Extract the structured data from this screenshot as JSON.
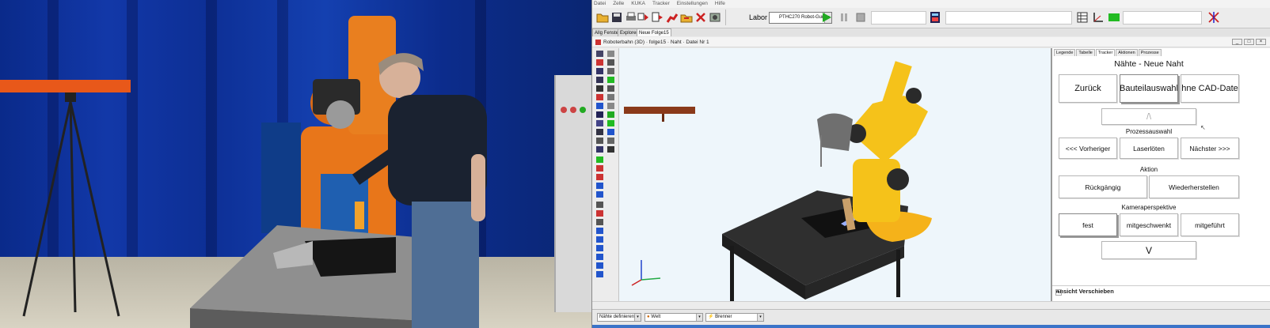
{
  "menu": [
    "Datei",
    "Zelle",
    "KUKA",
    "Tracker",
    "Einstellungen",
    "Hilfe"
  ],
  "toolbar": {
    "labor_label": "Labor",
    "robot_select_value": "PTHC270 Robot-Gun"
  },
  "doc_tabs": [
    "Allg Fenster",
    "Explorer",
    "Neue Folge15"
  ],
  "subwindow": {
    "title": "Roboterbahn (3D) · folge15 · Naht · Datei Nr 1"
  },
  "panel": {
    "tabs": [
      "Legende",
      "Tabelle",
      "Tracker",
      "Aktionen",
      "Prozesse"
    ],
    "title": "Nähte - Neue Naht",
    "back_label": "Zurück",
    "part_select_label": "Bauteilauswahl",
    "no_cad_label": "ohne CAD-Daten",
    "up_arrow": "/\\",
    "process_section": "Prozessauswahl",
    "prev_label": "<<< Vorheriger",
    "laser_label": "Laserlöten",
    "next_label": "Nächster >>>",
    "action_section": "Aktion",
    "undo_label": "Rückgängig",
    "redo_label": "Wiederherstellen",
    "camera_section": "Kameraperspektive",
    "cam_fixed_label": "fest",
    "cam_swivel_label": "mitgeschwenkt",
    "cam_follow_label": "mitgeführt",
    "down_arrow": "V",
    "footer": "Ansicht Verschieben"
  },
  "status": {
    "seams_select": "Nähte definieren",
    "world_select": "Welt",
    "tool_select": "Brenner"
  },
  "colors": {
    "robot_yellow": "#f5c21a",
    "curtain_blue": "#1238a8",
    "viewport_bg": "#eef6fb"
  }
}
